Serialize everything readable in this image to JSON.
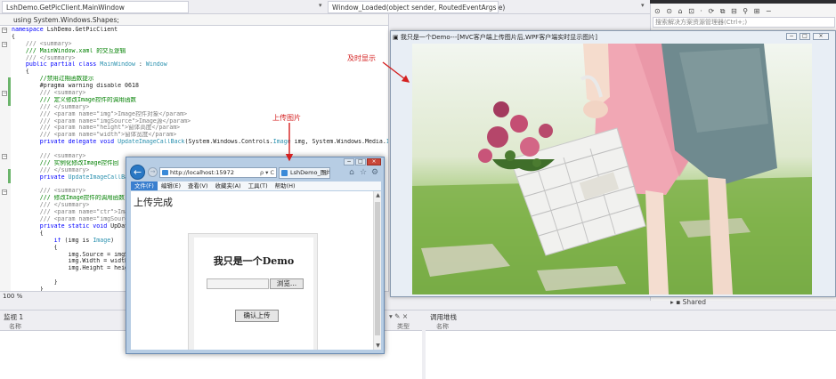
{
  "top_tabs": [
    {
      "label": "LshDemo.GetPicClient.MainWindow"
    },
    {
      "label": "Window_Loaded(object sender, RoutedEventArgs e)"
    }
  ],
  "editor": {
    "using_line": "using System.Windows.Shapes;",
    "zoom": "100 %",
    "lines": [
      [
        {
          "t": "namespace ",
          "c": "kw"
        },
        {
          "t": "LshDemo.GetPicClient",
          "c": "txt"
        }
      ],
      [
        {
          "t": "{",
          "c": "txt"
        }
      ],
      [
        {
          "t": "    /// <summary>",
          "c": "doc"
        }
      ],
      [
        {
          "t": "    /// MainWindow.xaml 的交互逻辑",
          "c": "com"
        }
      ],
      [
        {
          "t": "    /// </summary>",
          "c": "doc"
        }
      ],
      [
        {
          "t": "    public partial class ",
          "c": "kw"
        },
        {
          "t": "MainWindow",
          "c": "type"
        },
        {
          "t": " : ",
          "c": "txt"
        },
        {
          "t": "Window",
          "c": "type"
        }
      ],
      [
        {
          "t": "    {",
          "c": "txt"
        }
      ],
      [
        {
          "t": "        //禁用过期函数提示",
          "c": "com"
        }
      ],
      [
        {
          "t": "        #pragma warning disable 0618",
          "c": "txt"
        }
      ],
      [
        {
          "t": "        /// <summary>",
          "c": "doc"
        }
      ],
      [
        {
          "t": "        /// 定义修改Image控件的调用函数",
          "c": "com"
        }
      ],
      [
        {
          "t": "        /// </summary>",
          "c": "doc"
        }
      ],
      [
        {
          "t": "        /// <param name=\"img\">Image控件对象</param>",
          "c": "doc"
        }
      ],
      [
        {
          "t": "        /// <param name=\"imgSource\">Image源</param>",
          "c": "doc"
        }
      ],
      [
        {
          "t": "        /// <param name=\"height\">窗体高度</param>",
          "c": "doc"
        }
      ],
      [
        {
          "t": "        /// <param name=\"width\">窗体宽度</param>",
          "c": "doc"
        }
      ],
      [
        {
          "t": "        private delegate void ",
          "c": "kw"
        },
        {
          "t": "UpdateImageCallBack",
          "c": "type"
        },
        {
          "t": "(System.Windows.Controls.",
          "c": "txt"
        },
        {
          "t": "Image",
          "c": "type"
        },
        {
          "t": " img, System.Windows.Media.",
          "c": "txt"
        },
        {
          "t": "ImageSource",
          "c": "type"
        }
      ],
      [
        {
          "t": "",
          "c": "txt"
        }
      ],
      [
        {
          "t": "        /// <summary>",
          "c": "doc"
        }
      ],
      [
        {
          "t": "        /// 实例化修改Image控件回",
          "c": "com"
        }
      ],
      [
        {
          "t": "        /// </summary>",
          "c": "doc"
        }
      ],
      [
        {
          "t": "        private ",
          "c": "kw"
        },
        {
          "t": "UpdateImageCallBack",
          "c": "type"
        }
      ],
      [
        {
          "t": "",
          "c": "txt"
        }
      ],
      [
        {
          "t": "        /// <summary>",
          "c": "doc"
        }
      ],
      [
        {
          "t": "        /// 修改Image控件的调用函数",
          "c": "com"
        }
      ],
      [
        {
          "t": "        /// </summary>",
          "c": "doc"
        }
      ],
      [
        {
          "t": "        /// <param name=\"ctr\">Imag",
          "c": "doc"
        }
      ],
      [
        {
          "t": "        /// <param name=\"imgSource\">",
          "c": "doc"
        }
      ],
      [
        {
          "t": "        private static void ",
          "c": "kw"
        },
        {
          "t": "UpDate",
          "c": "txt"
        }
      ],
      [
        {
          "t": "        {",
          "c": "txt"
        }
      ],
      [
        {
          "t": "            if ",
          "c": "kw"
        },
        {
          "t": "(img is ",
          "c": "txt"
        },
        {
          "t": "Image",
          "c": "type"
        },
        {
          "t": ")",
          "c": "txt"
        }
      ],
      [
        {
          "t": "            {",
          "c": "txt"
        }
      ],
      [
        {
          "t": "                img.Source = imgSo",
          "c": "txt"
        }
      ],
      [
        {
          "t": "                img.Width = width;",
          "c": "txt"
        }
      ],
      [
        {
          "t": "                img.Height = heigh",
          "c": "txt"
        }
      ],
      [
        {
          "t": "",
          "c": "txt"
        }
      ],
      [
        {
          "t": "            }",
          "c": "txt"
        }
      ],
      [
        {
          "t": "        }",
          "c": "txt"
        }
      ]
    ]
  },
  "solution_explorer": {
    "search_placeholder": "搜索解决方案资源管理器(Ctrl+;)",
    "shared_label": "Shared"
  },
  "bottom": {
    "watch_title": "监视 1",
    "watch_col_name": "名称",
    "middle_col": "类型",
    "callstack_title": "调用堆栈",
    "callstack_col_name": "名称"
  },
  "demo_window": {
    "title": "我只是一个Demo---[MVC客户端上传图片后,WPF客户端实时显示图片]"
  },
  "ie_window": {
    "address": "http://localhost:15972",
    "address_controls": "ρ ▾ C",
    "tab_title": "LshDemo_图片上传客...",
    "menu": [
      "文件(F)",
      "编辑(E)",
      "查看(V)",
      "收藏夹(A)",
      "工具(T)",
      "帮助(H)"
    ],
    "status_text": "上传完成",
    "page_heading": "我只是一个Demo",
    "browse_button": "浏览...",
    "submit_button": "确认上传"
  },
  "annotations": {
    "realtime": "及时显示",
    "upload": "上传图片"
  },
  "colors": {
    "annotation": "#d42020",
    "comment": "#008000",
    "keyword": "#0000ff",
    "type": "#2b91af"
  }
}
